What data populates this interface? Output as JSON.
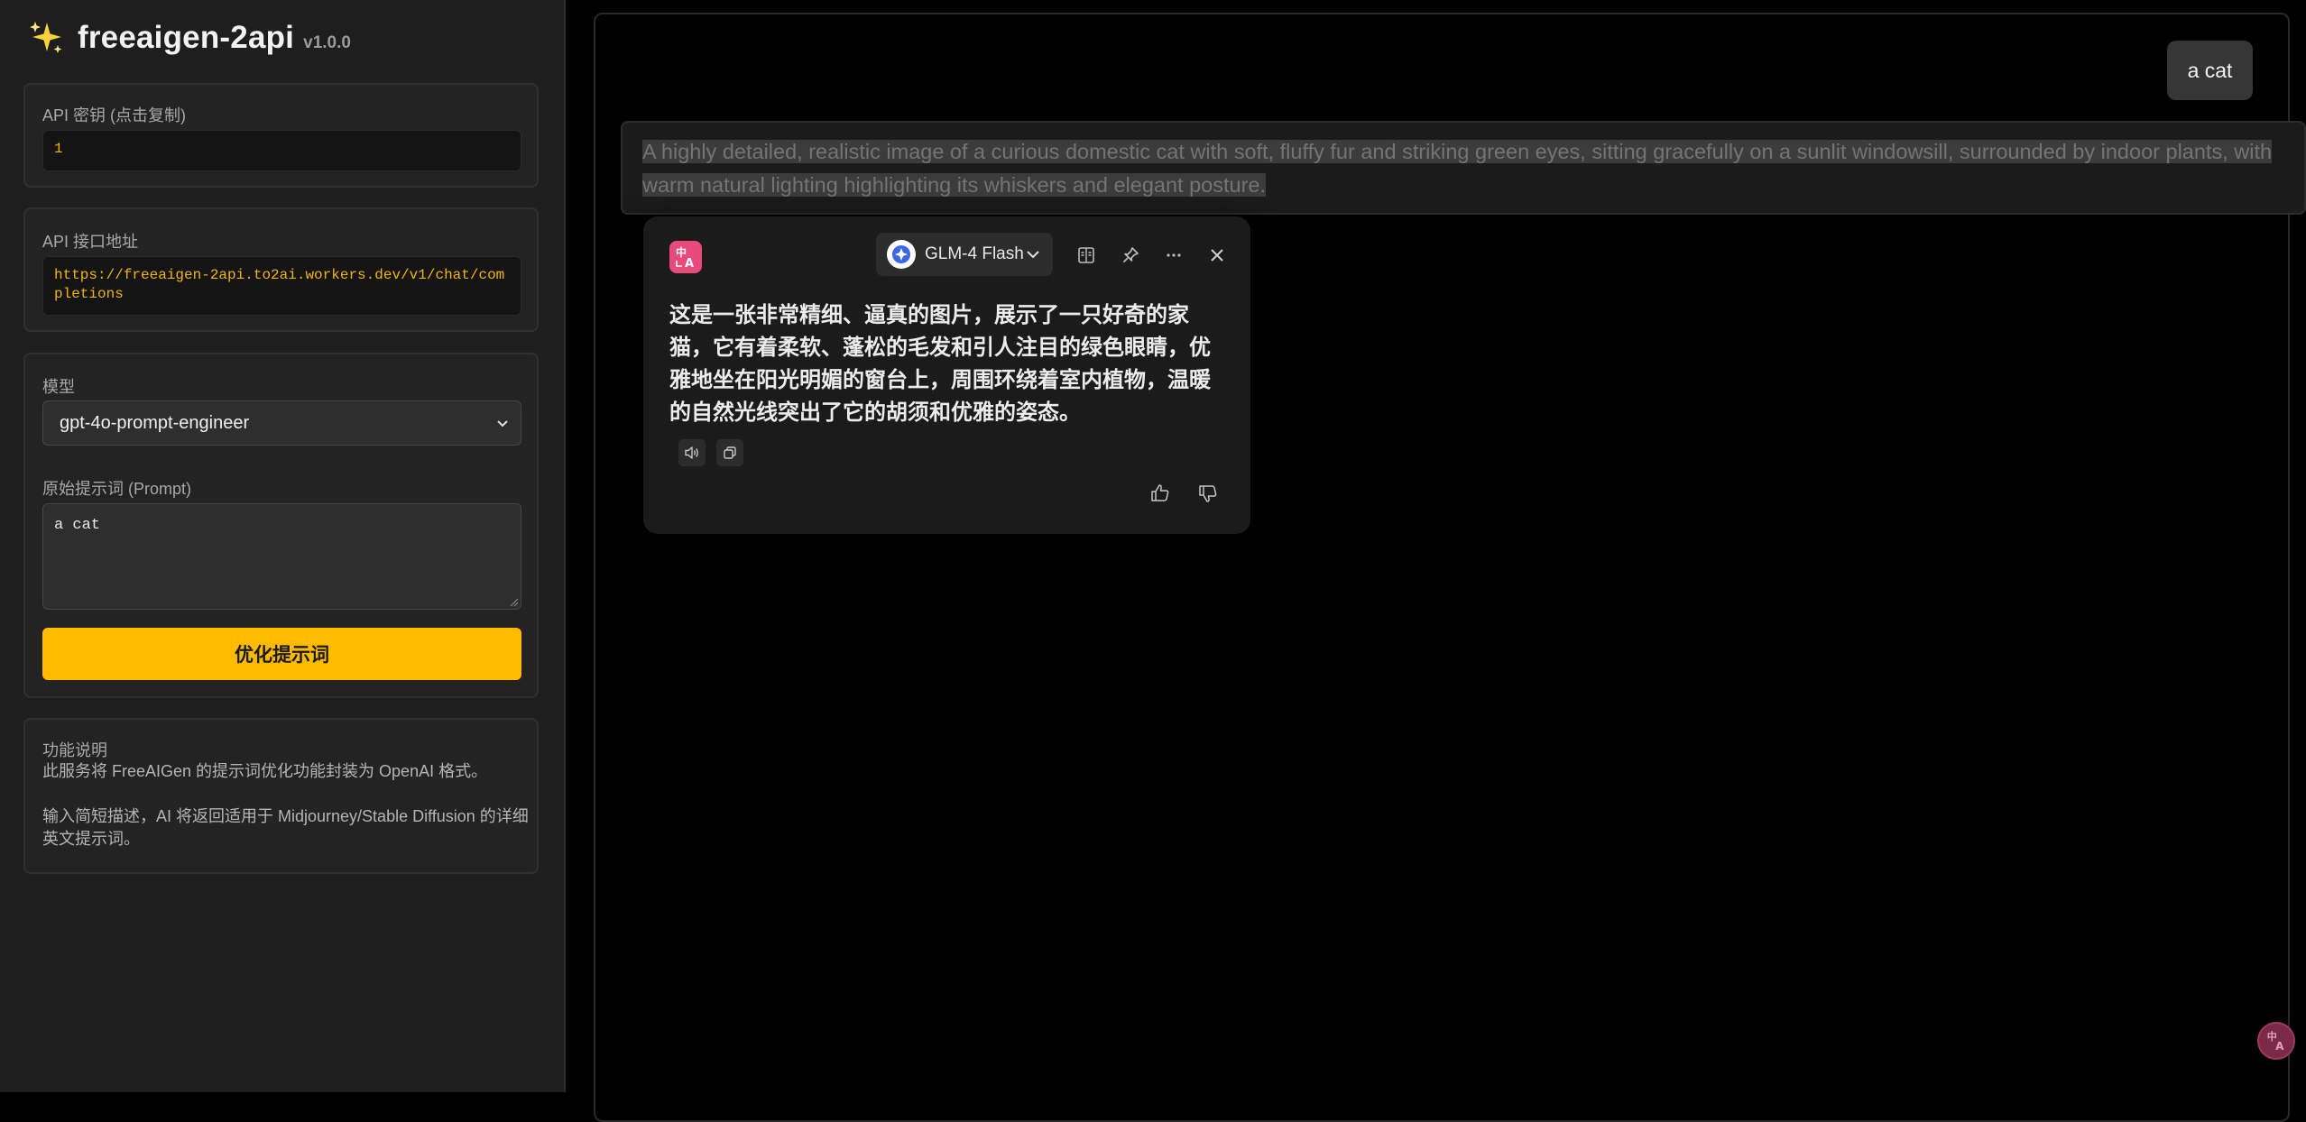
{
  "sidebar": {
    "brand": {
      "title": "freeaigen-2api",
      "version": "v1.0.0"
    },
    "api_key": {
      "label": "API 密钥 (点击复制)",
      "value": "1"
    },
    "endpoint": {
      "label": "API 接口地址",
      "value": "https://freeaigen-2api.to2ai.workers.dev/v1/chat/completions"
    },
    "model": {
      "label": "模型",
      "selected": "gpt-4o-prompt-engineer"
    },
    "prompt": {
      "label": "原始提示词 (Prompt)",
      "value": "a cat"
    },
    "submit_label": "优化提示词",
    "info": {
      "title": "功能说明",
      "line1": "此服务将 FreeAIGen 的提示词优化功能封装为 OpenAI 格式。",
      "line2": "输入简短描述，AI 将返回适用于 Midjourney/Stable Diffusion 的详细英文提示词。"
    }
  },
  "chat": {
    "user_message": "a cat",
    "assistant_message": "A highly detailed, realistic image of a curious domestic cat with soft, fluffy fur and striking green eyes, sitting gracefully on a sunlit windowsill, surrounded by indoor plants, with warm natural lighting highlighting its whiskers and elegant posture."
  },
  "translate_popup": {
    "model_name": "GLM-4 Flash",
    "translation": "这是一张非常精细、逼真的图片，展示了一只好奇的家猫，它有着柔软、蓬松的毛发和引人注目的绿色眼睛，优雅地坐在阳光明媚的窗台上，周围环绕着室内植物，温暖的自然光线突出了它的胡须和优雅的姿态。"
  },
  "colors": {
    "accent": "#ffbb00",
    "code_text": "#f5b400",
    "translate_brand": "#e84a7c"
  },
  "icons": {
    "brand": "sparkles-icon",
    "translate": "translate-icon",
    "model_logo": "glm-logo-icon",
    "compare": "split-view-icon",
    "pin": "pin-icon",
    "more": "more-icon",
    "close": "close-icon",
    "speaker": "speaker-icon",
    "copy": "copy-icon",
    "like": "thumbs-up-icon",
    "dislike": "thumbs-down-icon"
  }
}
